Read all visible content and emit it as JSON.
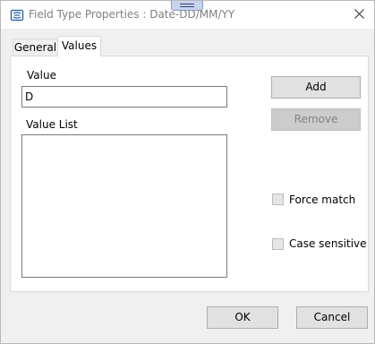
{
  "window": {
    "title": "Field Type Properties : Date-DD/MM/YY"
  },
  "tabs": [
    {
      "label": "General",
      "selected": false
    },
    {
      "label": "Values",
      "selected": true
    }
  ],
  "values_panel": {
    "value_label": "Value",
    "value_input": "D",
    "value_list_label": "Value List",
    "value_list_items": [],
    "add_label": "Add",
    "remove_label": "Remove",
    "force_match_label": "Force match",
    "force_match_checked": false,
    "case_sensitive_label": "Case sensitive",
    "case_sensitive_checked": false
  },
  "footer": {
    "ok_label": "OK",
    "cancel_label": "Cancel"
  },
  "icons": {
    "app": "field-type-icon",
    "close": "close-icon",
    "grip": "drag-grip-icon"
  },
  "colors": {
    "dialog_bg": "#f0f0f0",
    "panel_bg": "#ffffff",
    "button_bg": "#e1e1e1",
    "disabled_text": "#838383"
  }
}
